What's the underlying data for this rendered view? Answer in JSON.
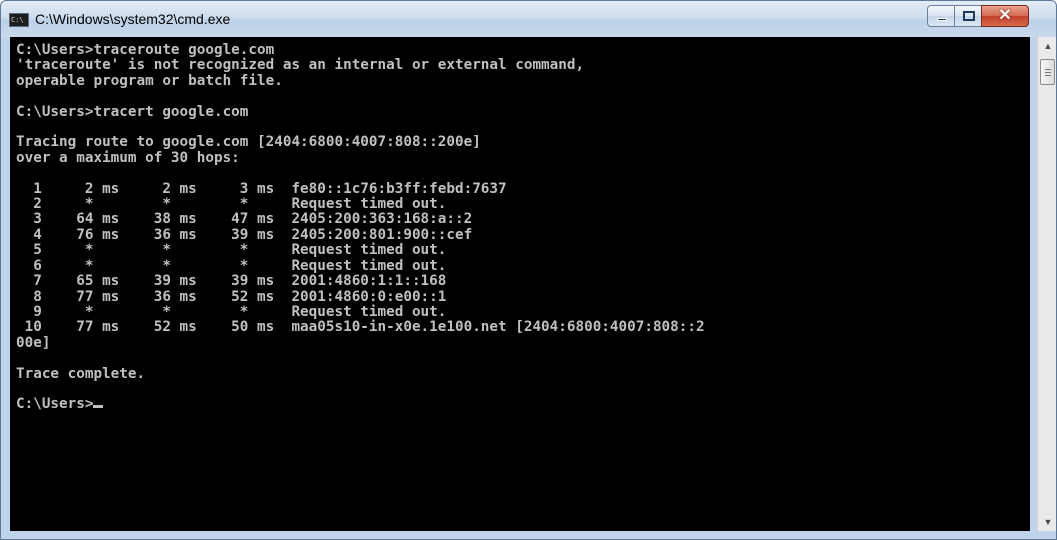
{
  "window": {
    "title": "C:\\Windows\\system32\\cmd.exe",
    "icon": "cmd-icon",
    "icon_text": "C:\\",
    "controls": {
      "minimize_icon": "minimize-icon",
      "maximize_icon": "maximize-icon",
      "close_icon": "close-icon",
      "close_glyph": "✕"
    }
  },
  "console": {
    "lines": [
      "C:\\Users>traceroute google.com",
      "'traceroute' is not recognized as an internal or external command,",
      "operable program or batch file.",
      "",
      "C:\\Users>tracert google.com",
      "",
      "Tracing route to google.com [2404:6800:4007:808::200e]",
      "over a maximum of 30 hops:",
      "",
      "  1     2 ms     2 ms     3 ms  fe80::1c76:b3ff:febd:7637",
      "  2     *        *        *     Request timed out.",
      "  3    64 ms    38 ms    47 ms  2405:200:363:168:a::2",
      "  4    76 ms    36 ms    39 ms  2405:200:801:900::cef",
      "  5     *        *        *     Request timed out.",
      "  6     *        *        *     Request timed out.",
      "  7    65 ms    39 ms    39 ms  2001:4860:1:1::168",
      "  8    77 ms    36 ms    52 ms  2001:4860:0:e00::1",
      "  9     *        *        *     Request timed out.",
      " 10    77 ms    52 ms    50 ms  maa05s10-in-x0e.1e100.net [2404:6800:4007:808::2",
      "00e]",
      "",
      "Trace complete.",
      ""
    ],
    "prompt": "C:\\Users>",
    "text_color": "#c0c0c0",
    "background_color": "#000000"
  },
  "scrollbar": {
    "up_icon": "scroll-up-arrow-icon",
    "up_glyph": "▲",
    "down_icon": "scroll-down-arrow-icon",
    "down_glyph": "▼"
  }
}
